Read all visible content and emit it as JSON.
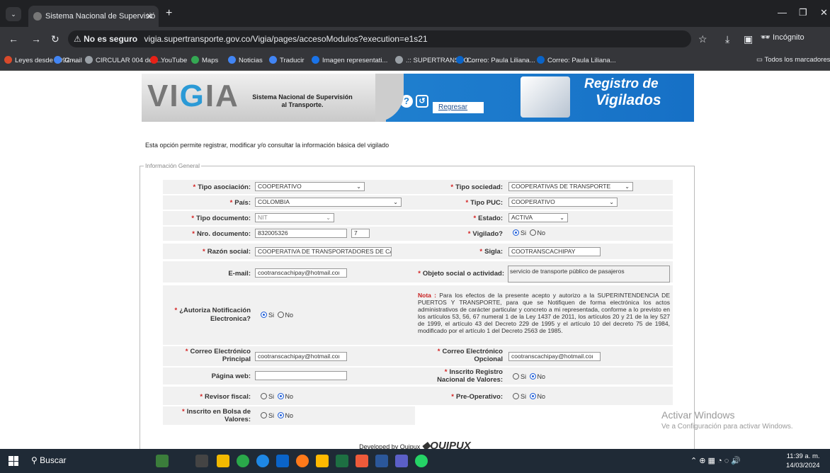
{
  "browser": {
    "tab_title": "Sistema Nacional de Supervisió",
    "tab_close": "✕",
    "new_tab": "+",
    "not_secure": "No es seguro",
    "url": "vigia.supertransporte.gov.co/Vigia/pages/accesoModulos?execution=e1s21",
    "incognito": "Incógnito",
    "bookmarks": [
      {
        "label": "Leyes desde 1992 -...",
        "color": "#d94a2b"
      },
      {
        "label": "Gmail",
        "color": "#4285f4"
      },
      {
        "label": "CIRCULAR 004 de 2...",
        "color": "#9aa0a6"
      },
      {
        "label": "YouTube",
        "color": "#e62117"
      },
      {
        "label": "Maps",
        "color": "#34a853"
      },
      {
        "label": "Noticias",
        "color": "#4285f4"
      },
      {
        "label": "Traducir",
        "color": "#4285f4"
      },
      {
        "label": "Imagen representati...",
        "color": "#1a73e8"
      },
      {
        "label": ".:: SUPERTRANSPO...",
        "color": "#9aa0a6"
      },
      {
        "label": "Correo: Paula Liliana...",
        "color": "#0a64c8"
      },
      {
        "label": "Correo: Paula Liliana...",
        "color": "#0a64c8"
      }
    ],
    "all_bookmarks": "Todos los marcadores"
  },
  "header": {
    "logo": "VIGIA",
    "system_name": "Sistema Nacional de Supervisión al Transporte.",
    "help": "?",
    "back_label": "Regresar",
    "title_line1": "Registro de",
    "title_line2": "Vigilados"
  },
  "intro": "Esta opción permite registrar, modificar y/o consultar la información básica del vigilado",
  "legend": "Información General",
  "form": {
    "tipo_asociacion": {
      "label": "Tipo asociación:",
      "value": "COOPERATIVO"
    },
    "tipo_sociedad": {
      "label": "Tipo sociedad:",
      "value": "COOPERATIVAS DE TRANSPORTE"
    },
    "pais": {
      "label": "País:",
      "value": "COLOMBIA"
    },
    "tipo_puc": {
      "label": "Tipo PUC:",
      "value": "COOPERATIVO"
    },
    "tipo_documento": {
      "label": "Tipo documento:",
      "value": "NIT"
    },
    "estado": {
      "label": "Estado:",
      "value": "ACTIVA"
    },
    "nro_documento": {
      "label": "Nro. documento:",
      "value": "832005326",
      "dv": "7"
    },
    "vigilado": {
      "label": "Vigilado?",
      "si": "Si",
      "no": "No"
    },
    "razon_social": {
      "label": "Razón social:",
      "value": "COOPERATIVA DE TRANSPORTADORES DE CAC"
    },
    "sigla": {
      "label": "Sigla:",
      "value": "COOTRANSCACHIPAY"
    },
    "email": {
      "label": "E-mail:",
      "value": "cootranscachipay@hotmail.coı"
    },
    "objeto_social": {
      "label": "Objeto social o actividad:",
      "value": "servicio de transporte público de pasajeros"
    },
    "autoriza": {
      "label": "¿Autoriza Notificación Electronica?",
      "si": "Si",
      "no": "No"
    },
    "nota_title": "Nota :",
    "nota_text": "Para los efectos de la presente acepto y autorizo a la SUPERINTENDENCIA DE PUERTOS Y TRANSPORTE, para que se Notifiquen de forma electrónica los actos administrativos de carácter particular y concreto a mi representada, conforme a lo previsto en los artículos 53, 56, 67 numeral 1 de la Ley 1437 de 2011, los artículos 20 y 21 de la ley 527 de 1999, el artículo 43 del Decreto 229 de 1995 y el artículo 10 del decreto 75 de 1984, modificado por el artículo 1 del Decreto 2563 de 1985.",
    "correo_principal": {
      "label": "Correo Electrónico Principal",
      "value": "cootranscachipay@hotmail.coı"
    },
    "correo_opcional": {
      "label": "Correo Electrónico Opcional",
      "value": "cootranscachipay@hotmail.coı"
    },
    "pagina_web": {
      "label": "Página web:",
      "value": ""
    },
    "inscrito_rnv": {
      "label": "Inscrito Registro Nacional de Valores:",
      "si": "Si",
      "no": "No"
    },
    "revisor": {
      "label": "Revisor fiscal:",
      "si": "Si",
      "no": "No"
    },
    "preoperativo": {
      "label": "Pre-Operativo:",
      "si": "Si",
      "no": "No"
    },
    "bolsa": {
      "label": "Inscrito en Bolsa de Valores:",
      "si": "Si",
      "no": "No"
    }
  },
  "footer": {
    "developed": "Developed by Quipux",
    "brand": "QUIPUX"
  },
  "watermark": {
    "line1": "Activar Windows",
    "line2": "Ve a Configuración para activar Windows."
  },
  "taskbar": {
    "search": "Buscar",
    "time": "11:39 a. m.",
    "date": "14/03/2024"
  }
}
